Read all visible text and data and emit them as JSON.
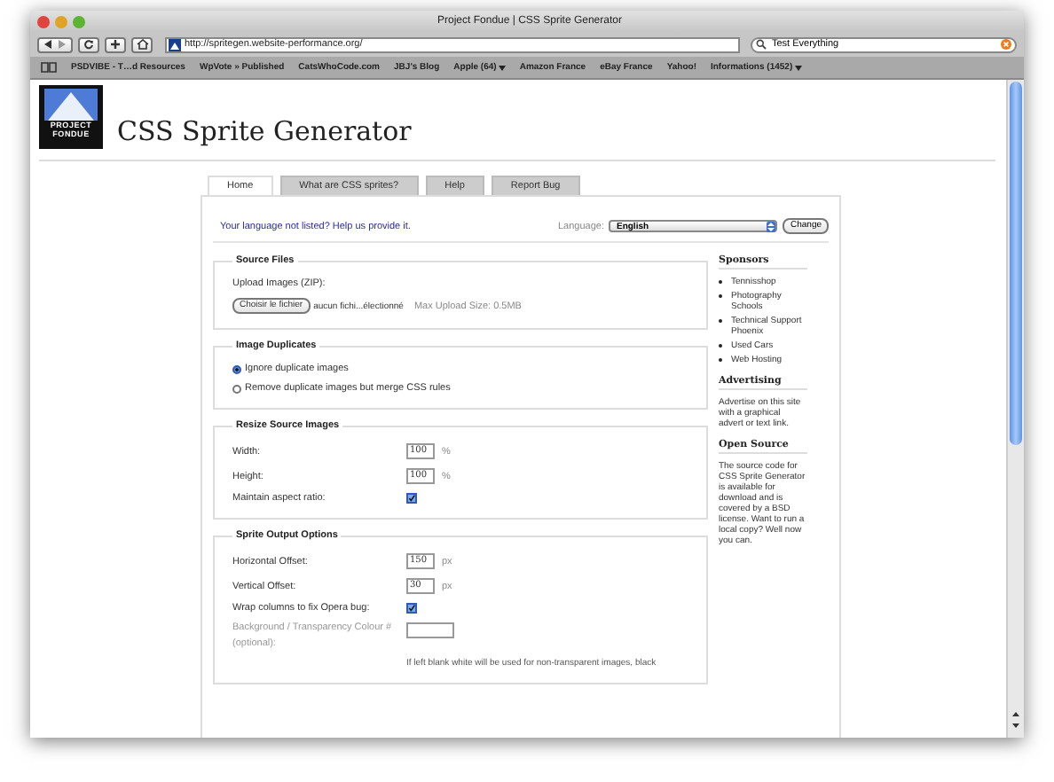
{
  "window": {
    "title": "Project Fondue | CSS Sprite Generator"
  },
  "toolbar": {
    "url": "http://spritegen.website-performance.org/",
    "search": "Test Everything"
  },
  "bookmarks": [
    {
      "label": "PSDVIBE - T…d Resources",
      "menu": false
    },
    {
      "label": "WpVote » Published",
      "menu": false
    },
    {
      "label": "CatsWhoCode.com",
      "menu": false
    },
    {
      "label": "JBJ's Blog",
      "menu": false
    },
    {
      "label": "Apple (64)",
      "menu": true
    },
    {
      "label": "Amazon France",
      "menu": false
    },
    {
      "label": "eBay France",
      "menu": false
    },
    {
      "label": "Yahoo!",
      "menu": false
    },
    {
      "label": "Informations (1452)",
      "menu": true
    }
  ],
  "page": {
    "logo": [
      "PROJECT",
      "FONDUE"
    ],
    "heading": "CSS Sprite Generator"
  },
  "tabs": [
    {
      "label": "Home",
      "selected": true
    },
    {
      "label": "What are CSS sprites?",
      "selected": false
    },
    {
      "label": "Help",
      "selected": false
    },
    {
      "label": "Report Bug",
      "selected": false
    }
  ],
  "language": {
    "prompt": "Your language not listed? Help us provide it.",
    "label": "Language:",
    "value": "English",
    "button": "Change"
  },
  "sections": [
    {
      "title": "Source Files",
      "rows": [
        {
          "kind": "label",
          "label": "Upload Images (ZIP):"
        },
        {
          "kind": "file",
          "button": "Choisir le fichier",
          "status": "aucun fichi...électionné",
          "hint": "Max Upload Size: 0.5MB"
        }
      ]
    },
    {
      "title": "Image Duplicates",
      "rows": [
        {
          "kind": "radio",
          "label": "Ignore duplicate images",
          "selected": true
        },
        {
          "kind": "radio",
          "label": "Remove duplicate images but merge CSS rules",
          "selected": false
        }
      ]
    },
    {
      "title": "Resize Source Images",
      "rows": [
        {
          "kind": "number",
          "label": "Width:",
          "value": "100",
          "unit": "%"
        },
        {
          "kind": "number",
          "label": "Height:",
          "value": "100",
          "unit": "%"
        },
        {
          "kind": "checkbox",
          "label": "Maintain aspect ratio:",
          "checked": true
        }
      ]
    },
    {
      "title": "Sprite Output Options",
      "rows": [
        {
          "kind": "number",
          "label": "Horizontal Offset:",
          "value": "150",
          "unit": "px"
        },
        {
          "kind": "number",
          "label": "Vertical Offset:",
          "value": "30",
          "unit": "px"
        },
        {
          "kind": "checkbox",
          "label": "Wrap columns to fix Opera bug:",
          "checked": true
        },
        {
          "kind": "color",
          "label": "Background / Transparency Colour #",
          "sub": "(optional):",
          "disabled": true
        },
        {
          "kind": "note",
          "label": "If left blank white will be used for non-transparent images, black"
        }
      ]
    }
  ],
  "sidebar": [
    {
      "title": "Sponsors",
      "links": [
        "Tennisshop",
        "Photography Schools",
        "Technical Support Phoenix",
        "Used Cars",
        "Web Hosting"
      ]
    },
    {
      "title": "Advertising",
      "text": "Advertise on this site with a graphical advert or text link."
    },
    {
      "title": "Open Source",
      "text": "The source code for CSS Sprite Generator is available for download and is covered by a BSD license. Want to run a local copy? Well now you can."
    }
  ]
}
